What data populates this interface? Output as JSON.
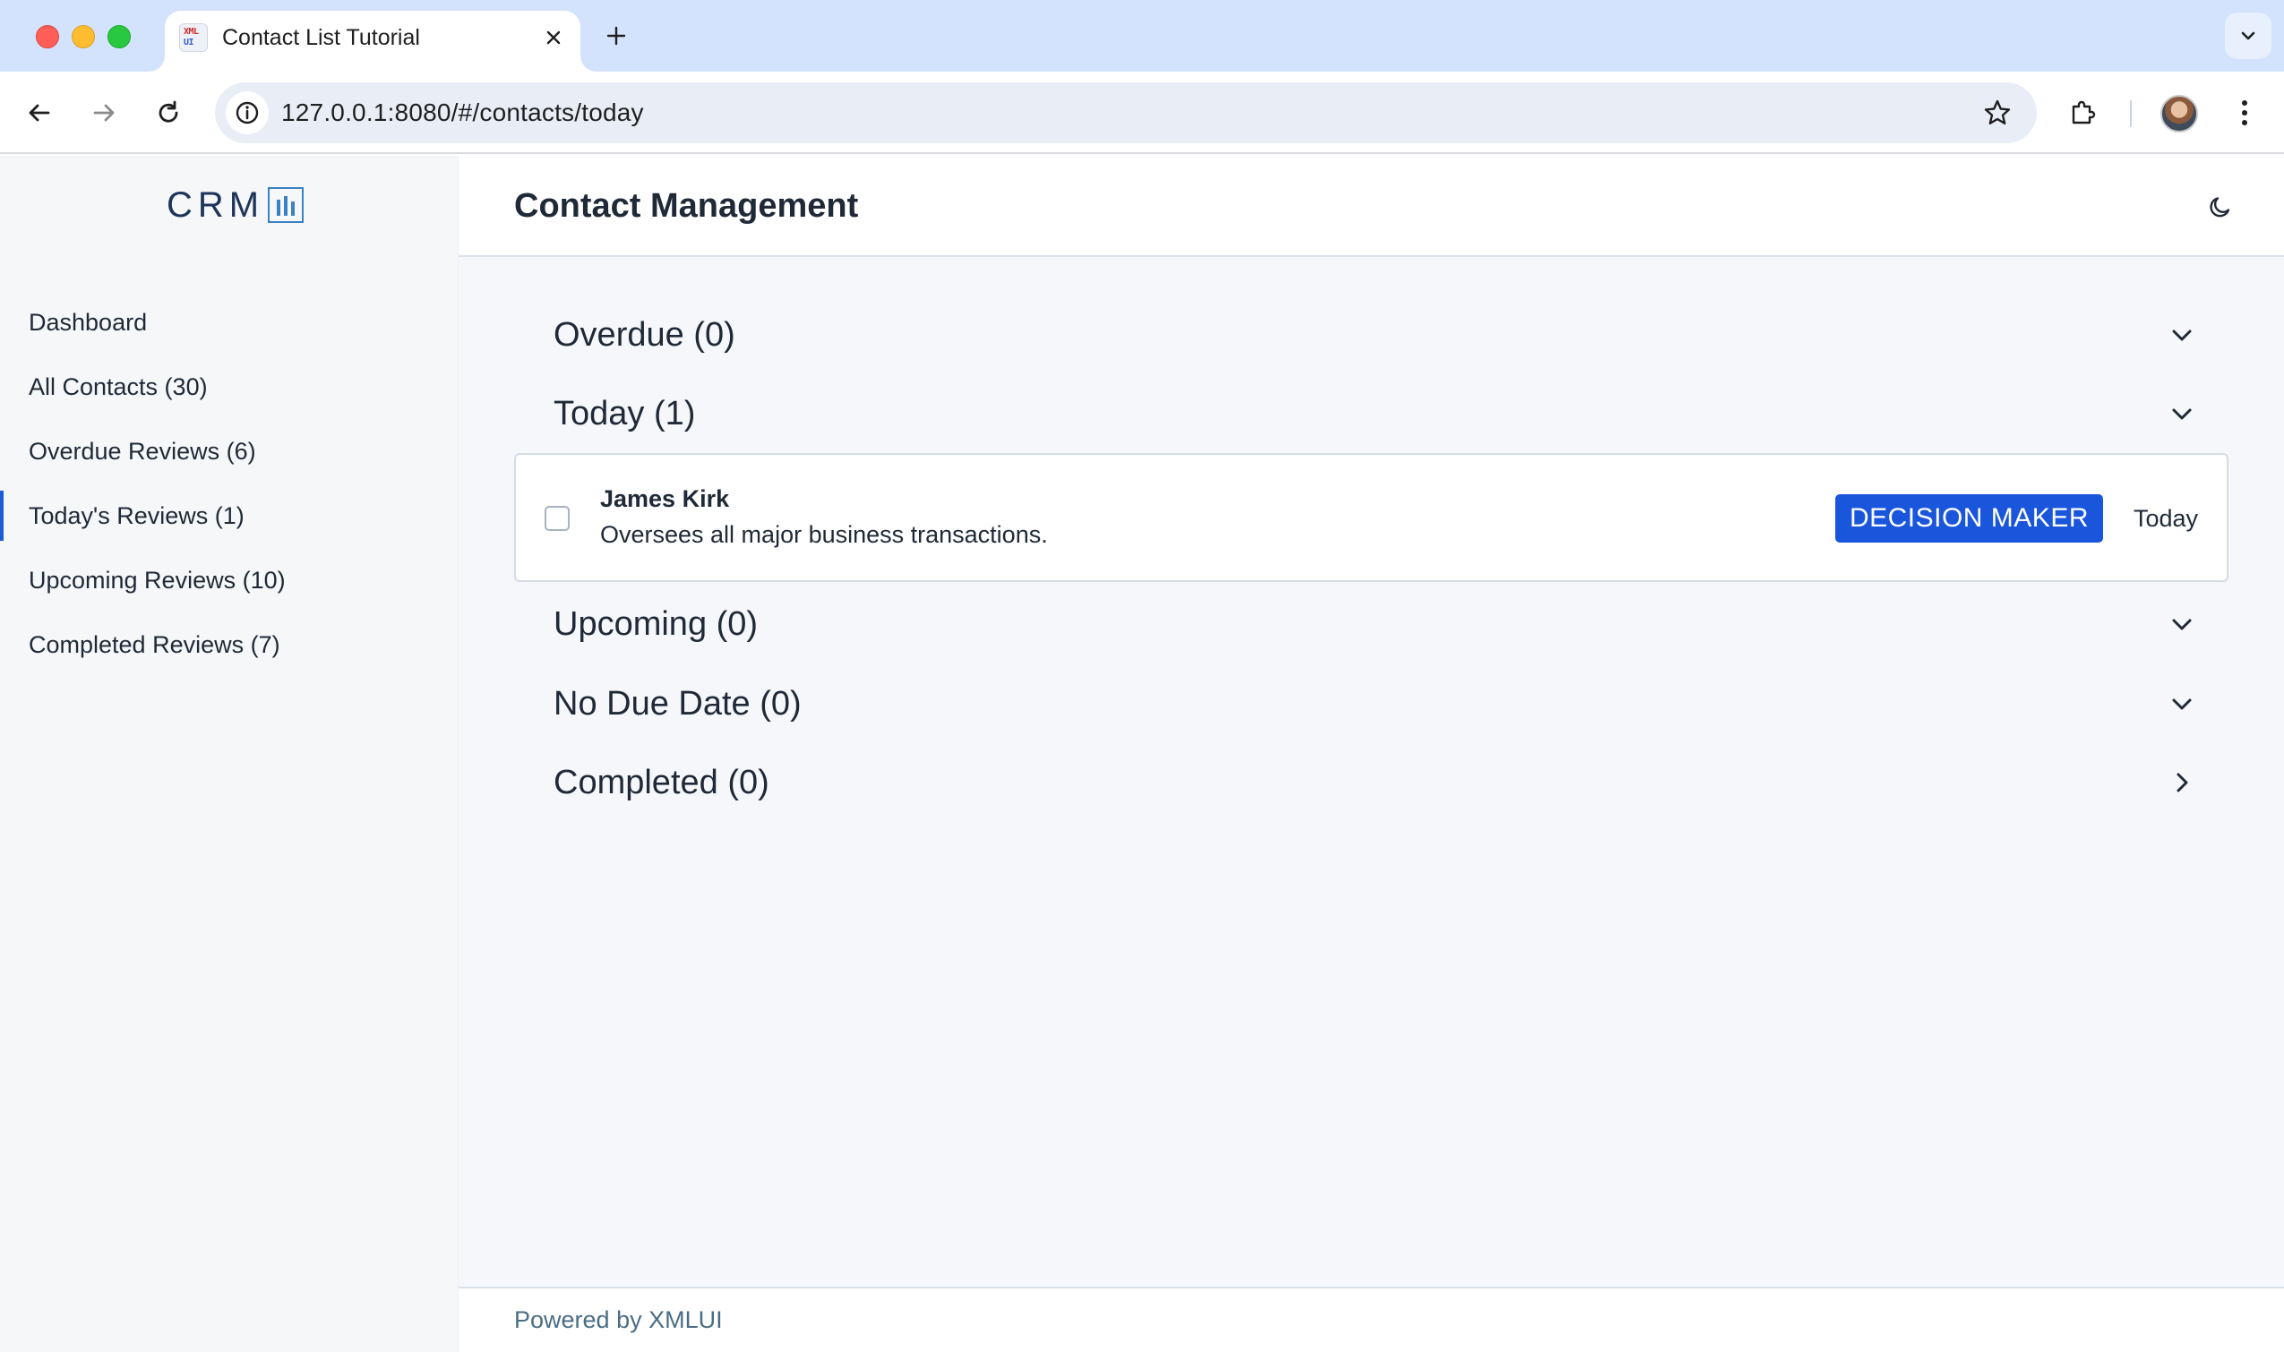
{
  "browser": {
    "tab": {
      "title": "Contact List Tutorial",
      "favicon_text_top": "XML",
      "favicon_text_bottom": "UI"
    },
    "address": {
      "url": "127.0.0.1:8080/#/contacts/today"
    },
    "icons": {
      "close": "close-icon",
      "new_tab": "plus-icon",
      "tab_search": "chevron-down-icon",
      "back": "arrow-left-icon",
      "forward": "arrow-right-icon",
      "reload": "reload-icon",
      "site_info": "info-icon",
      "bookmark": "star-icon",
      "extensions": "puzzle-icon",
      "menu": "kebab-menu-icon"
    }
  },
  "sidebar": {
    "logo": {
      "text": "CRM",
      "mark": "bar-chart-icon"
    },
    "items": [
      {
        "label": "Dashboard",
        "active": false
      },
      {
        "label": "All Contacts (30)",
        "active": false
      },
      {
        "label": "Overdue Reviews (6)",
        "active": false
      },
      {
        "label": "Today's Reviews (1)",
        "active": true
      },
      {
        "label": "Upcoming Reviews (10)",
        "active": false
      },
      {
        "label": "Completed Reviews (7)",
        "active": false
      }
    ]
  },
  "header": {
    "title": "Contact Management",
    "theme_icon": "moon-icon"
  },
  "sections": [
    {
      "title": "Overdue (0)",
      "expanded": true
    },
    {
      "title": "Today (1)",
      "expanded": true
    },
    {
      "title": "Upcoming (0)",
      "expanded": true
    },
    {
      "title": "No Due Date (0)",
      "expanded": true
    },
    {
      "title": "Completed (0)",
      "expanded": false
    }
  ],
  "contacts": [
    {
      "name": "James Kirk",
      "description": "Oversees all major business transactions.",
      "badge": "DECISION MAKER",
      "due": "Today",
      "checked": false
    }
  ],
  "footer": {
    "text": "Powered by XMLUI"
  },
  "colors": {
    "accent": "#1a56db",
    "active_nav_indicator": "#1d5cd8",
    "logo": "#1e3559"
  }
}
